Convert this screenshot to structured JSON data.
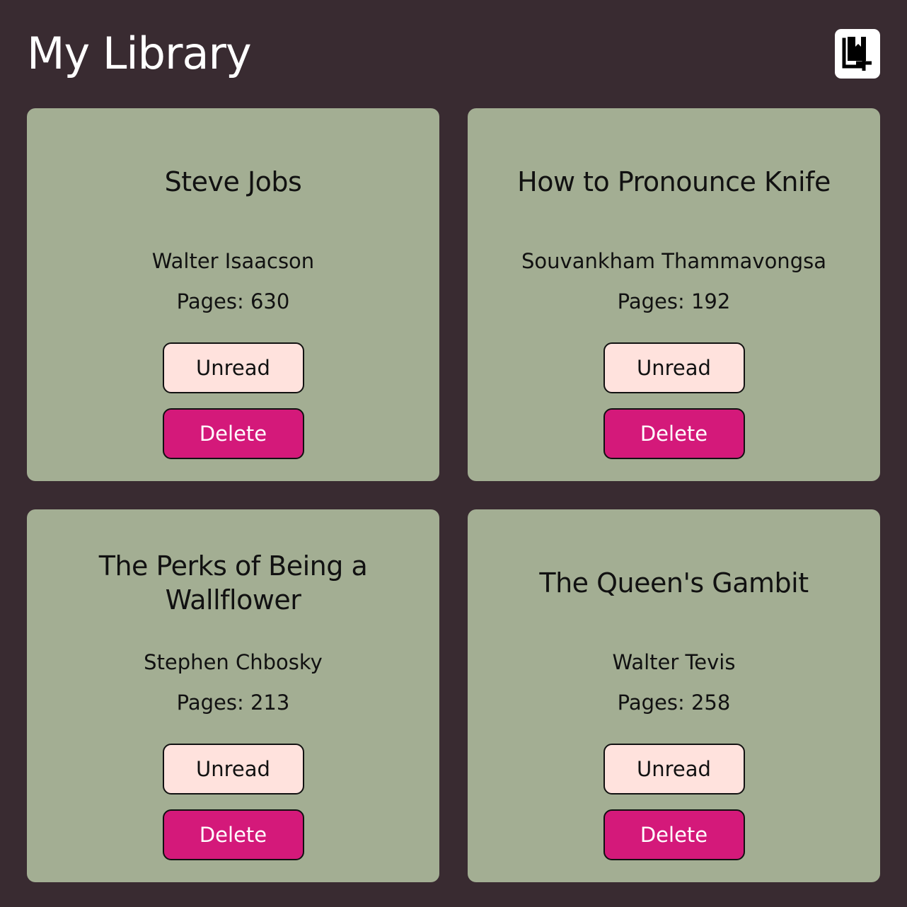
{
  "header": {
    "title": "My Library",
    "add_button_icon": "add-book-icon"
  },
  "books": [
    {
      "title": "Steve Jobs",
      "author": "Walter Isaacson",
      "pages": "Pages: 630",
      "status_label": "Unread",
      "delete_label": "Delete"
    },
    {
      "title": "How to Pronounce Knife",
      "author": "Souvankham Thammavongsa",
      "pages": "Pages: 192",
      "status_label": "Unread",
      "delete_label": "Delete"
    },
    {
      "title": "The Perks of Being a Wallflower",
      "author": "Stephen Chbosky",
      "pages": "Pages: 213",
      "status_label": "Unread",
      "delete_label": "Delete"
    },
    {
      "title": "The Queen's Gambit",
      "author": "Walter Tevis",
      "pages": "Pages: 258",
      "status_label": "Unread",
      "delete_label": "Delete"
    }
  ],
  "colors": {
    "background": "#392b31",
    "card": "#a3ae93",
    "status_button": "#ffe2dd",
    "delete_button": "#d4197a"
  }
}
